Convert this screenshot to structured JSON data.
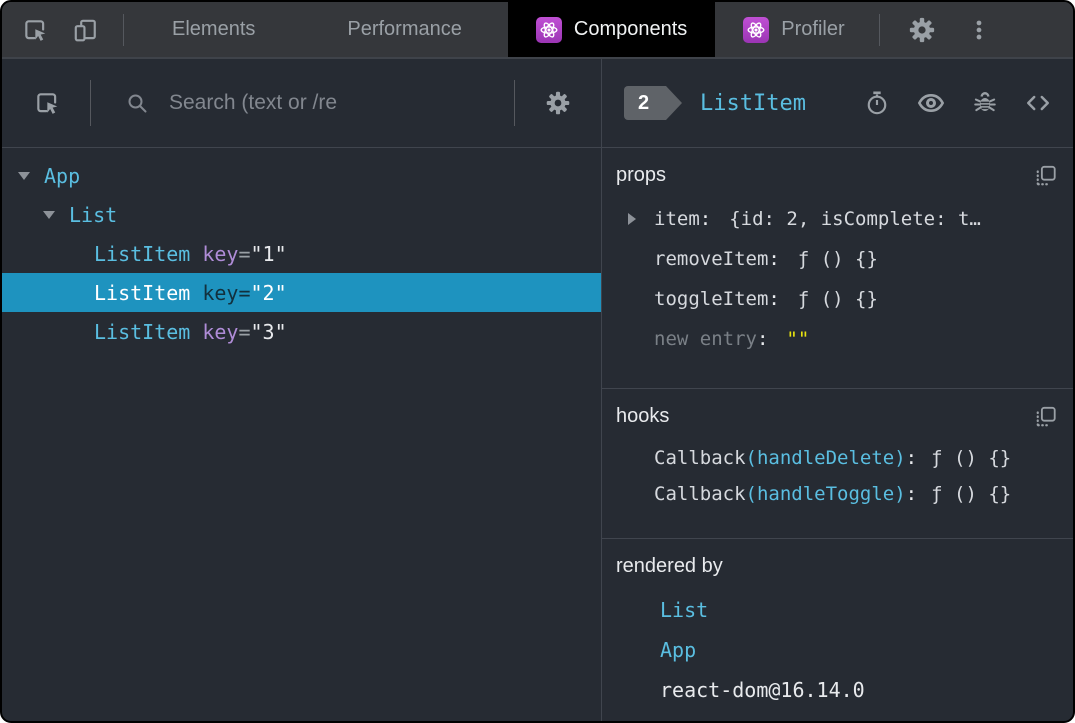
{
  "strings": {
    "colon": ":"
  },
  "colors": {
    "accent_cyan": "#5abee1",
    "selected_row": "#1e93bf",
    "key_purple": "#af8cd7",
    "value_yellow": "#e8e410",
    "react_purple": "#a73cc0",
    "tabbar_bg": "#35373b",
    "panel_bg": "#262b33"
  },
  "tabbar": {
    "tabs": [
      {
        "label": "Elements"
      },
      {
        "label": "Performance"
      },
      {
        "label": "Components"
      },
      {
        "label": "Profiler"
      }
    ]
  },
  "left_panel": {
    "search": {
      "placeholder": "Search (text or /re"
    },
    "tree": {
      "rows": [
        {
          "name": "App"
        },
        {
          "name": "List"
        },
        {
          "name": "ListItem",
          "attr": "key",
          "op": "=",
          "value": "\"1\""
        },
        {
          "name": "ListItem",
          "attr": "key",
          "op": "=",
          "value": "\"2\""
        },
        {
          "name": "ListItem",
          "attr": "key",
          "op": "=",
          "value": "\"3\""
        }
      ]
    }
  },
  "right_panel": {
    "header": {
      "badge": "2",
      "title": "ListItem"
    },
    "props": {
      "title": "props",
      "rows": [
        {
          "name": "item",
          "value": "{id: 2, isComplete: t…"
        },
        {
          "name": "removeItem",
          "value": "ƒ () {}"
        },
        {
          "name": "toggleItem",
          "value": "ƒ () {}"
        },
        {
          "name": "new entry",
          "value": "\"\""
        }
      ]
    },
    "hooks": {
      "title": "hooks",
      "rows": [
        {
          "name": "Callback",
          "detail": "(handleDelete)",
          "value": "ƒ () {}"
        },
        {
          "name": "Callback",
          "detail": "(handleToggle)",
          "value": "ƒ () {}"
        }
      ]
    },
    "rendered_by": {
      "title": "rendered by",
      "items": [
        {
          "label": "List"
        },
        {
          "label": "App"
        },
        {
          "label": "react-dom@16.14.0"
        }
      ]
    }
  }
}
